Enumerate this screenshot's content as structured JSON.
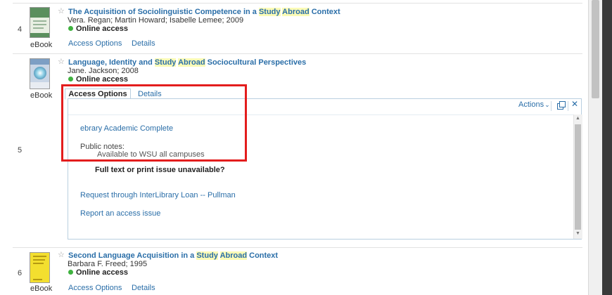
{
  "results": [
    {
      "number": "4",
      "title_parts": [
        "The Acquisition of Sociolinguistic Competence in a ",
        "Study",
        " ",
        "Abroad",
        " Context"
      ],
      "authors": "Vera. Regan; Martin Howard; Isabelle Lemee; 2009",
      "availability": "Online access",
      "type": "eBook",
      "link_access": "Access Options",
      "link_details": "Details"
    },
    {
      "number": "5",
      "title_parts": [
        "Language, Identity and ",
        "Study",
        " ",
        "Abroad",
        " Sociocultural Perspectives"
      ],
      "authors": "Jane. Jackson; 2008",
      "availability": "Online access",
      "type": "eBook",
      "tab_access": "Access Options",
      "tab_details": "Details"
    },
    {
      "number": "6",
      "title_parts": [
        "Second Language Acquisition in a ",
        "Study",
        " ",
        "Abroad",
        " Context"
      ],
      "authors": "Barbara F. Freed; 1995",
      "availability": "Online access",
      "type": "eBook",
      "link_access": "Access Options",
      "link_details": "Details"
    }
  ],
  "panel": {
    "actions_label": "Actions",
    "source_link": "ebrary Academic Complete",
    "public_notes_label": "Public notes:",
    "public_notes_value": "Available to WSU all campuses",
    "unavailable_heading": "Full text or print issue unavailable?",
    "request_link": "Request through InterLibrary Loan -- Pullman",
    "report_link": "Report an access issue"
  },
  "colors": {
    "link": "#2a6ea8",
    "highlight": "#fbfbb6",
    "online_dot": "#3fb23f",
    "annotation_box": "#e31d1d"
  }
}
